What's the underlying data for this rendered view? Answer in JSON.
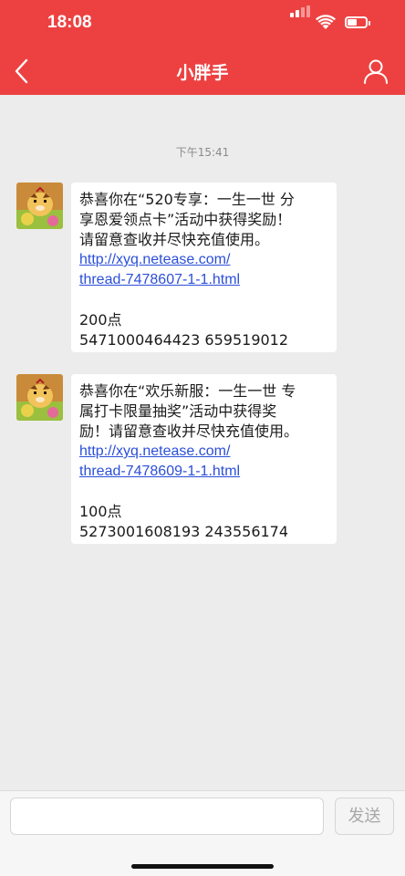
{
  "status_bar": {
    "time": "18:08"
  },
  "nav": {
    "title": "小胖手",
    "back_icon": "chevron-left-icon",
    "user_icon": "user-icon"
  },
  "colors": {
    "header": "#ed4141",
    "link": "#2b4fd8",
    "background": "#ececec"
  },
  "chat": {
    "timestamp": "下午15:41",
    "messages": [
      {
        "lines": [
          "恭喜你在“520专享：一生一世 分",
          "享恩爱领点卡”活动中获得奖励！",
          "请留意查收并尽快充值使用。"
        ],
        "link_lines": [
          "http://xyq.netease.com/",
          "thread-7478607-1-1.html"
        ],
        "points": "200点",
        "code": "5471000464423 659519012"
      },
      {
        "lines": [
          "恭喜你在“欢乐新服：一生一世 专",
          "属打卡限量抽奖”活动中获得奖",
          "励！请留意查收并尽快充值使用。"
        ],
        "link_lines": [
          "http://xyq.netease.com/",
          "thread-7478609-1-1.html"
        ],
        "points": "100点",
        "code": "5273001608193 243556174"
      }
    ]
  },
  "input_bar": {
    "input_value": "",
    "send_label": "发送"
  }
}
